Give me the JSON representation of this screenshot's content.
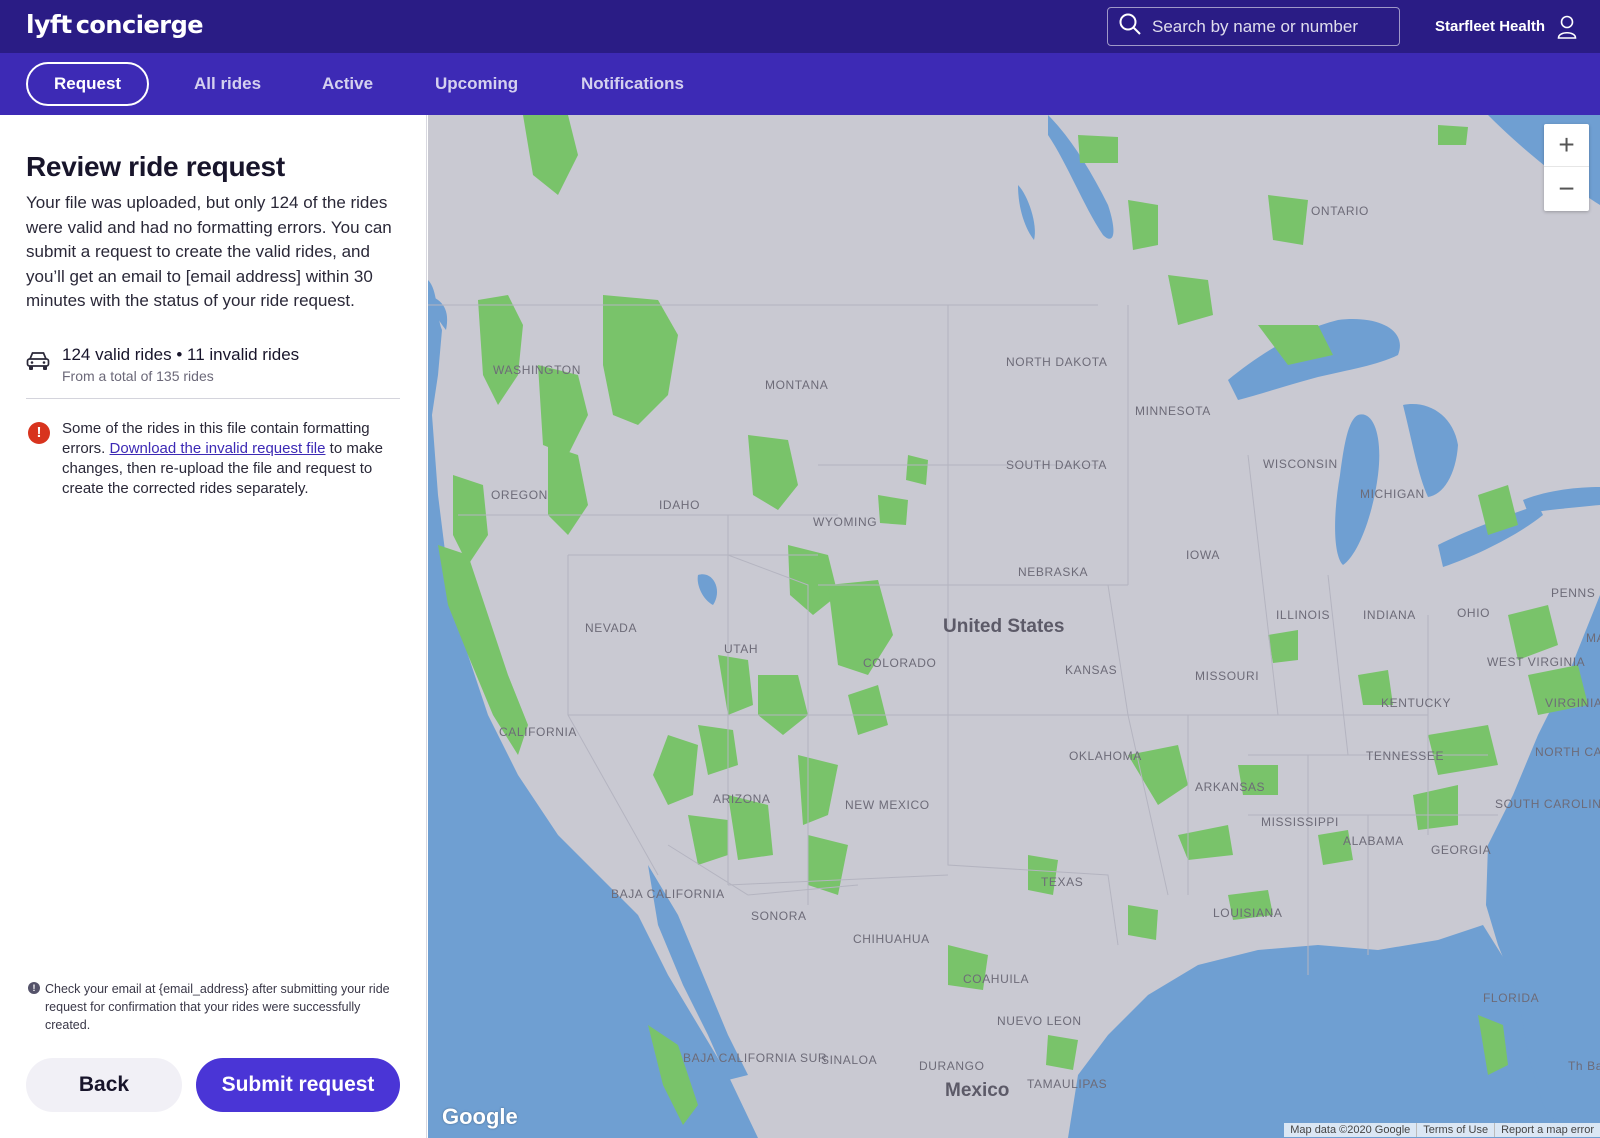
{
  "header": {
    "brand": "lyft",
    "product": "concierge",
    "search_placeholder": "Search by name or number",
    "account_name": "Starfleet Health"
  },
  "nav": {
    "tabs": [
      {
        "label": "Request",
        "active": true
      },
      {
        "label": "All rides",
        "active": false
      },
      {
        "label": "Active",
        "active": false
      },
      {
        "label": "Upcoming",
        "active": false
      },
      {
        "label": "Notifications",
        "active": false
      }
    ]
  },
  "panel": {
    "title": "Review ride request",
    "description": "Your file was uploaded, but only 124 of the rides were valid and had no formatting errors. You can submit a request to create the valid rides, and you’ll get an email to [email address] within 30 minutes with the status of your ride request.",
    "summary": {
      "main": "124 valid rides • 11 invalid rides",
      "sub": "From a total of 135 rides"
    },
    "alert": {
      "before": "Some of the rides in this file contain formatting errors. ",
      "link": "Download the invalid request file",
      "after": " to make changes, then re-upload the file and request to create the corrected rides separately."
    },
    "note": "Check your email at {email_address} after submitting your ride request for confirmation that your rides were successfully created.",
    "back_label": "Back",
    "submit_label": "Submit request"
  },
  "map": {
    "zoom_in": "+",
    "zoom_out": "−",
    "google": "Google",
    "attribution": [
      "Map data ©2020 Google",
      "Terms of Use",
      "Report a map error"
    ],
    "country_labels": [
      "United States",
      "Mexico"
    ],
    "region_labels": [
      "ONTARIO",
      "WASHINGTON",
      "MONTANA",
      "NORTH DAKOTA",
      "MINNESOTA",
      "OREGON",
      "IDAHO",
      "SOUTH DAKOTA",
      "WISCONSIN",
      "MICHIGAN",
      "WYOMING",
      "IOWA",
      "NEBRASKA",
      "NEVADA",
      "UTAH",
      "COLORADO",
      "ILLINOIS",
      "INDIANA",
      "OHIO",
      "PENNS",
      "KANSAS",
      "MISSOURI",
      "WEST VIRGINIA",
      "VIRGINIA",
      "CALIFORNIA",
      "KENTUCKY",
      "OKLAHOMA",
      "TENNESSEE",
      "NORTH CAROLINA",
      "ARIZONA",
      "NEW MEXICO",
      "ARKANSAS",
      "SOUTH CAROLINA",
      "MISSISSIPPI",
      "ALABAMA",
      "GEORGIA",
      "TEXAS",
      "LOUISIANA",
      "BAJA CALIFORNIA",
      "SONORA",
      "CHIHUAHUA",
      "COAHUILA",
      "FLORIDA",
      "NUEVO LEON",
      "BAJA CALIFORNIA SUR",
      "SINALOA",
      "DURANGO",
      "TAMAULIPAS",
      "MA",
      "Th Baha"
    ],
    "colors": {
      "water": "#6f9fd2",
      "land": "#c9c9d2",
      "park": "#79c36a"
    }
  }
}
